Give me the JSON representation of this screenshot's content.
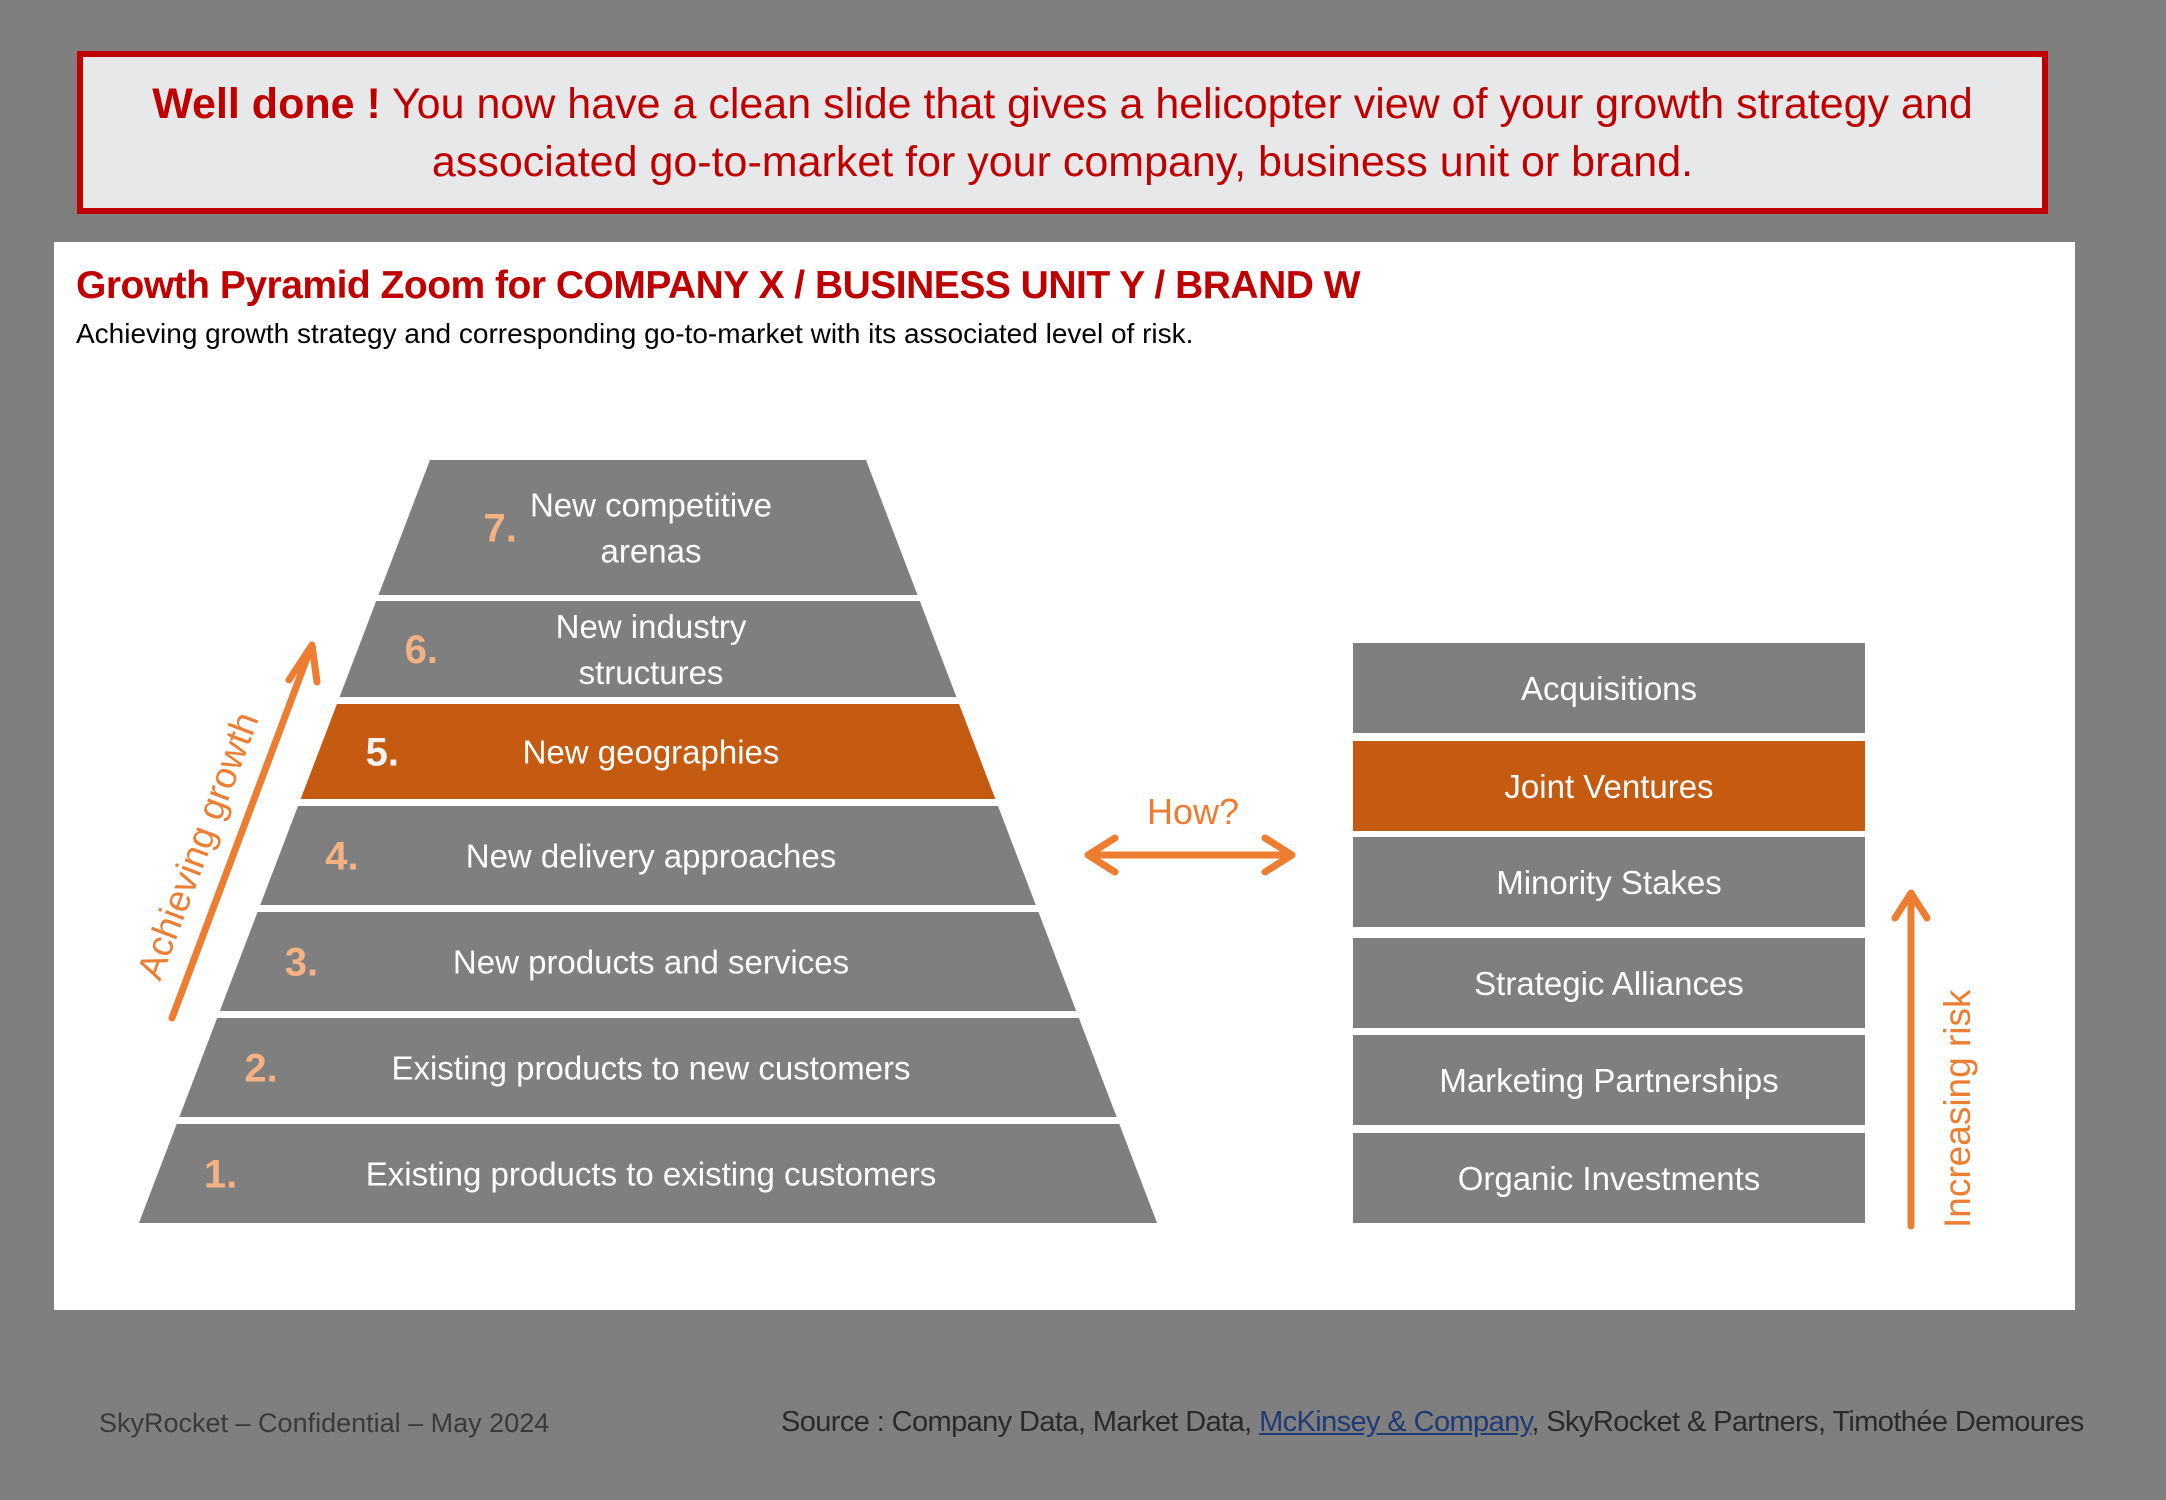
{
  "banner": {
    "bold": "Well done !",
    "text": " You now have a clean slide that gives a helicopter view of your growth strategy and associated go-to-market for your company, business unit or brand."
  },
  "slide": {
    "title": "Growth Pyramid Zoom for COMPANY X / BUSINESS UNIT Y / BRAND W",
    "subtitle": "Achieving growth strategy and corresponding go-to-market with its associated level of risk."
  },
  "colors": {
    "gray": "#7f7f7f",
    "highlight": "#c55a11",
    "accent": "#ed7d31",
    "number": "#f4b183",
    "title_red": "#c00000"
  },
  "pyramid": {
    "axis_label": "Achieving growth",
    "tiers": [
      {
        "number": "7.",
        "lines": [
          "New competitive",
          "arenas"
        ],
        "highlighted": false
      },
      {
        "number": "6.",
        "lines": [
          "New industry",
          "structures"
        ],
        "highlighted": false
      },
      {
        "number": "5.",
        "lines": [
          "New geographies"
        ],
        "highlighted": true
      },
      {
        "number": "4.",
        "lines": [
          "New delivery approaches"
        ],
        "highlighted": false
      },
      {
        "number": "3.",
        "lines": [
          "New products and services"
        ],
        "highlighted": false
      },
      {
        "number": "2.",
        "lines": [
          "Existing products to new customers"
        ],
        "highlighted": false
      },
      {
        "number": "1.",
        "lines": [
          "Existing products to existing customers"
        ],
        "highlighted": false
      }
    ]
  },
  "connector": {
    "label": "How?"
  },
  "go_to_market": {
    "axis_label": "Increasing risk",
    "items": [
      {
        "label": "Acquisitions",
        "highlighted": false
      },
      {
        "label": "Joint Ventures",
        "highlighted": true
      },
      {
        "label": "Minority Stakes",
        "highlighted": false
      },
      {
        "label": "Strategic Alliances",
        "highlighted": false
      },
      {
        "label": "Marketing Partnerships",
        "highlighted": false
      },
      {
        "label": "Organic Investments",
        "highlighted": false
      }
    ]
  },
  "footer": {
    "left": "SkyRocket – Confidential – May 2024",
    "source_prefix": "Source : Company Data, Market Data, ",
    "source_link": "McKinsey & Company",
    "source_suffix": ", SkyRocket & Partners, Timothée Demoures"
  }
}
